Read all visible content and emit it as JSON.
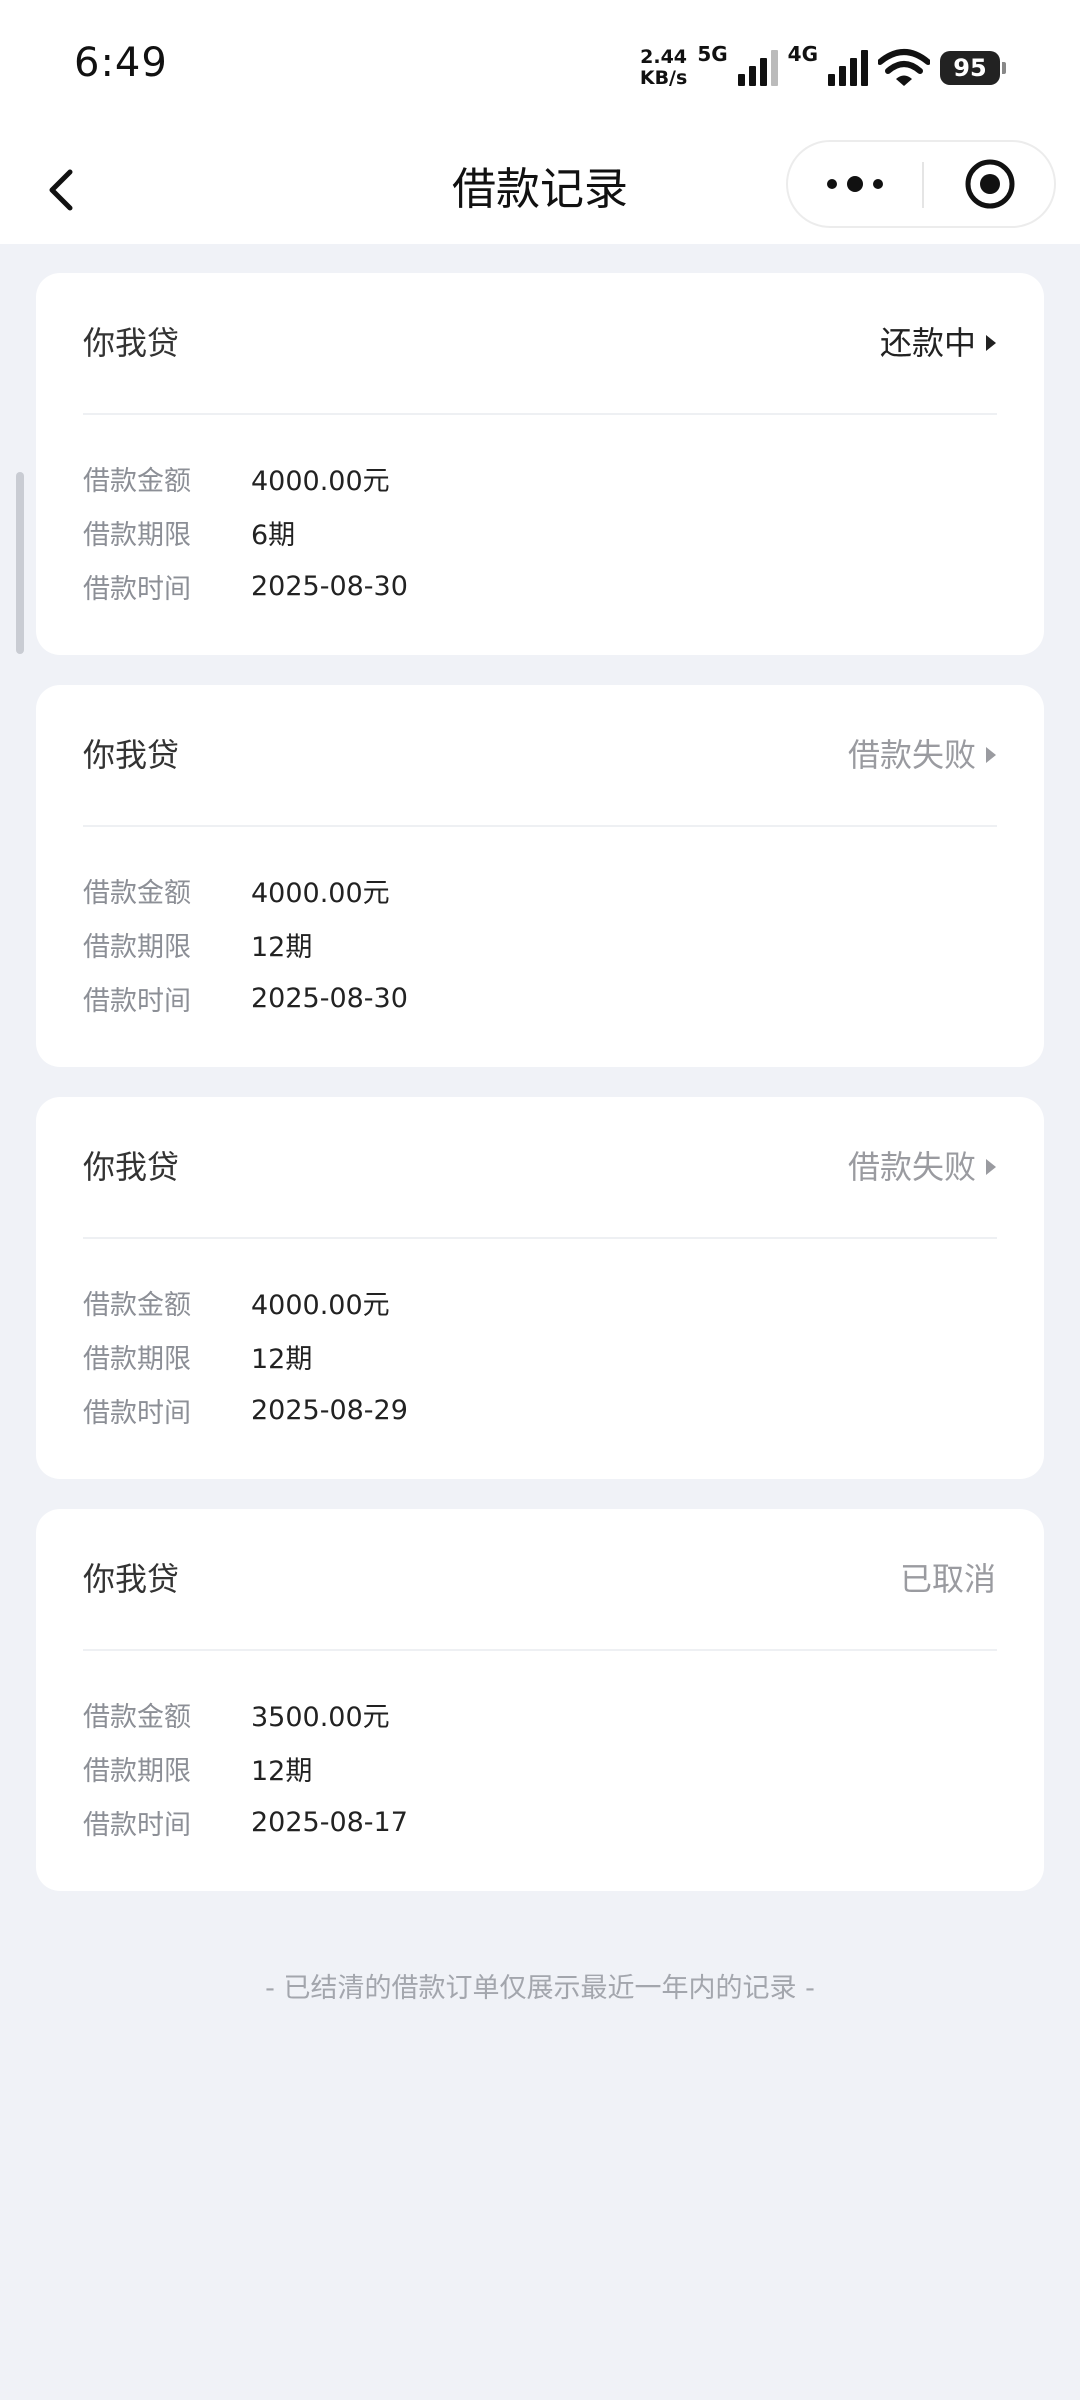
{
  "status_bar": {
    "time": "6:49",
    "net_speed_value": "2.44",
    "net_speed_unit": "KB/s",
    "network_1": "5G",
    "network_2": "4G",
    "battery": "95"
  },
  "header": {
    "title": "借款记录",
    "back_icon": "chevron-left-icon",
    "more_icon": "more-dots-icon",
    "close_icon": "target-circle-icon"
  },
  "labels": {
    "amount": "借款金额",
    "term": "借款期限",
    "date": "借款时间"
  },
  "loans": [
    {
      "name": "你我贷",
      "status": "还款中",
      "amount": "4000.00元",
      "term": "6期",
      "date": "2025-08-30"
    },
    {
      "name": "你我贷",
      "status": "借款失败",
      "amount": "4000.00元",
      "term": "12期",
      "date": "2025-08-30"
    },
    {
      "name": "你我贷",
      "status": "借款失败",
      "amount": "4000.00元",
      "term": "12期",
      "date": "2025-08-29"
    },
    {
      "name": "你我贷",
      "status": "已取消",
      "amount": "3500.00元",
      "term": "12期",
      "date": "2025-08-17"
    }
  ],
  "footer_note": "- 已结清的借款订单仅展示最近一年内的记录 -",
  "colors": {
    "background": "#f0f2f7",
    "card": "#ffffff",
    "status_active": "#222222",
    "status_muted": "#9a9ba0"
  }
}
